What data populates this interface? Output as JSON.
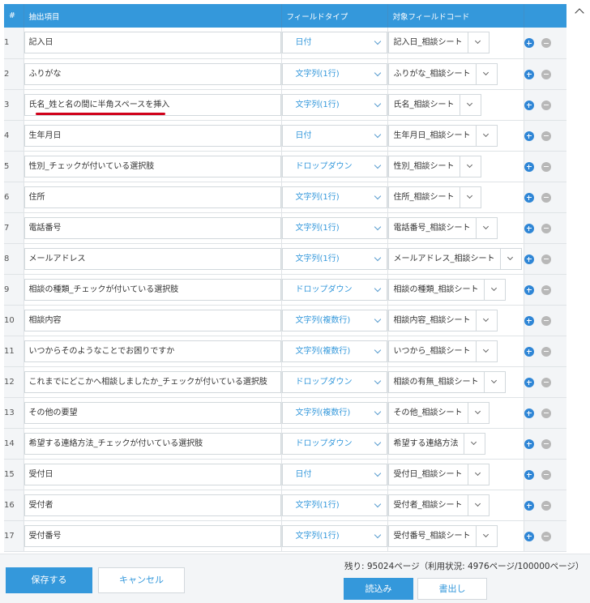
{
  "table": {
    "headers": {
      "num": "#",
      "field": "抽出項目",
      "type": "フィールドタイプ",
      "target": "対象フィールドコード"
    },
    "rows": [
      {
        "num": "1",
        "field": "記入日",
        "type": "日付",
        "target": "記入日_相談シート"
      },
      {
        "num": "2",
        "field": "ふりがな",
        "type": "文字列(1行)",
        "target": "ふりがな_相談シート"
      },
      {
        "num": "3",
        "field": "氏名_姓と名の間に半角スペースを挿入",
        "type": "文字列(1行)",
        "target": "氏名_相談シート"
      },
      {
        "num": "4",
        "field": "生年月日",
        "type": "日付",
        "target": "生年月日_相談シート"
      },
      {
        "num": "5",
        "field": "性別_チェックが付いている選択肢",
        "type": "ドロップダウン",
        "target": "性別_相談シート"
      },
      {
        "num": "6",
        "field": "住所",
        "type": "文字列(1行)",
        "target": "住所_相談シート"
      },
      {
        "num": "7",
        "field": "電話番号",
        "type": "文字列(1行)",
        "target": "電話番号_相談シート"
      },
      {
        "num": "8",
        "field": "メールアドレス",
        "type": "文字列(1行)",
        "target": "メールアドレス_相談シート"
      },
      {
        "num": "9",
        "field": "相談の種類_チェックが付いている選択肢",
        "type": "ドロップダウン",
        "target": "相談の種類_相談シート"
      },
      {
        "num": "10",
        "field": "相談内容",
        "type": "文字列(複数行)",
        "target": "相談内容_相談シート"
      },
      {
        "num": "11",
        "field": "いつからそのようなことでお困りですか",
        "type": "文字列(複数行)",
        "target": "いつから_相談シート"
      },
      {
        "num": "12",
        "field": "これまでにどこかへ相談しましたか_チェックが付いている選択肢",
        "type": "ドロップダウン",
        "target": "相談の有無_相談シート"
      },
      {
        "num": "13",
        "field": "その他の要望",
        "type": "文字列(複数行)",
        "target": "その他_相談シート"
      },
      {
        "num": "14",
        "field": "希望する連絡方法_チェックが付いている選択肢",
        "type": "ドロップダウン",
        "target": "希望する連絡方法"
      },
      {
        "num": "15",
        "field": "受付日",
        "type": "日付",
        "target": "受付日_相談シート"
      },
      {
        "num": "16",
        "field": "受付者",
        "type": "文字列(1行)",
        "target": "受付者_相談シート"
      },
      {
        "num": "17",
        "field": "受付番号",
        "type": "文字列(1行)",
        "target": "受付番号_相談シート"
      }
    ]
  },
  "footer": {
    "save_label": "保存する",
    "cancel_label": "キャンセル",
    "usage_text": "残り: 95024ページ（利用状況: 4976ページ/100000ページ）",
    "load_label": "読込み",
    "export_label": "書出し"
  },
  "colors": {
    "accent": "#3498db",
    "highlight_underline": "#d0021b"
  },
  "icons": {
    "add": "plus-circle-icon",
    "remove": "minus-circle-icon",
    "scroll": "chevron-up-icon"
  }
}
